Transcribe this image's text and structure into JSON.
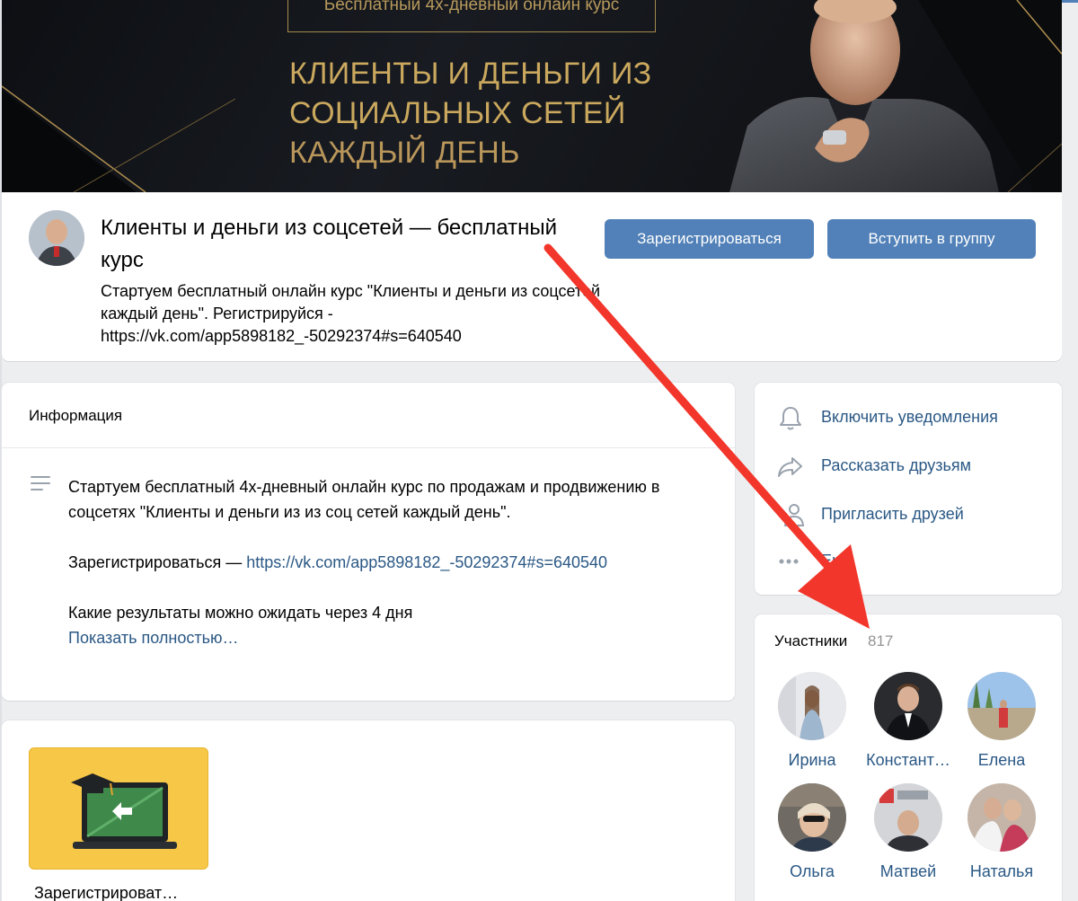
{
  "cover": {
    "pill_text": "Бесплатный 4х-дневный онлайн курс",
    "title_line1": "КЛИЕНТЫ И ДЕНЬГИ ИЗ",
    "title_line2": "СОЦИАЛЬНЫХ СЕТЕЙ",
    "title_line3": "КАЖДЫЙ ДЕНЬ"
  },
  "group": {
    "name": "Клиенты и деньги из соцсетей — бесплатный курс",
    "status": "Стартуем бесплатный онлайн курс \"Клиенты и деньги из соцсетей каждый день\". Регистрируйся - https://vk.com/app5898182_-50292374#s=640540"
  },
  "buttons": {
    "register": "Зарегистрироваться",
    "join": "Вступить в группу"
  },
  "info": {
    "title": "Информация",
    "paragraph1": "Стартуем бесплатный 4х-дневный онлайн курс по продажам и продвижению в соцсетях \"Клиенты и деньги из из соц сетей каждый день\".",
    "register_prefix": "Зарегистрироваться — ",
    "register_link": "https://vk.com/app5898182_-50292374#s=640540",
    "paragraph3": "Какие результаты можно ожидать через 4 дня",
    "show_more": "Показать полностью…"
  },
  "app": {
    "label": "Зарегистрироват…"
  },
  "actions": {
    "notify": "Включить уведомления",
    "share": "Рассказать друзьям",
    "invite": "Пригласить друзей",
    "more": "Ещё"
  },
  "members": {
    "title": "Участники",
    "count": "817",
    "list": [
      {
        "name": "Ирина"
      },
      {
        "name": "Констант…"
      },
      {
        "name": "Елена"
      },
      {
        "name": "Ольга"
      },
      {
        "name": "Матвей"
      },
      {
        "name": "Наталья"
      }
    ]
  },
  "colors": {
    "accent": "#5181b8",
    "link": "#2a5885",
    "gold": "#caa85e",
    "annotation_arrow": "#f2362b"
  }
}
